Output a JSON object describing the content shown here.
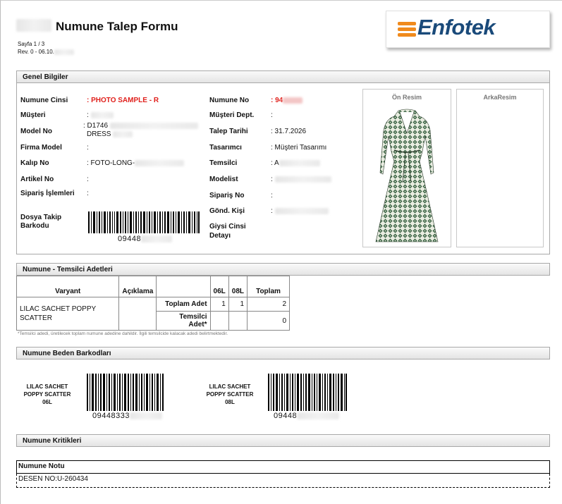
{
  "header": {
    "title": "Numune Talep Formu",
    "page": "Sayfa 1 / 3",
    "revision": "Rev. 0 - 06.10.",
    "logo_text": "Enfotek"
  },
  "sections": {
    "general": "Genel Bilgiler",
    "counts": "Numune - Temsilci Adetleri",
    "barcodes": "Numune Beden Barkodları",
    "criticals": "Numune Kritikleri"
  },
  "general": {
    "left": [
      {
        "label": "Numune Cinsi",
        "value": ": PHOTO SAMPLE - R"
      },
      {
        "label": "Müşteri",
        "value": ":"
      },
      {
        "label": "Model No",
        "value": ": D1746",
        "value2": "DRESS"
      },
      {
        "label": "Firma Model",
        "value": ":"
      },
      {
        "label": "Kalıp No",
        "value": ": FOTO-LONG-"
      },
      {
        "label": "Artikel No",
        "value": ":"
      },
      {
        "label": "Sipariş İşlemleri",
        "value": ":"
      },
      {
        "label": "Dosya Takip Barkodu",
        "value": "09448"
      }
    ],
    "right": [
      {
        "label": "Numune No",
        "value": ": 94"
      },
      {
        "label": "Müşteri Dept.",
        "value": ":"
      },
      {
        "label": "Talep Tarihi",
        "value": ": 31.7.2026"
      },
      {
        "label": "Tasarımcı",
        "value": ": Müşteri Tasarımı"
      },
      {
        "label": "Temsilci",
        "value": ": A"
      },
      {
        "label": "Modelist",
        "value": ":"
      },
      {
        "label": "Sipariş No",
        "value": ":"
      },
      {
        "label": "Gönd. Kişi",
        "value": ":"
      },
      {
        "label": "Giysi Cinsi Detayı",
        "value": ""
      }
    ],
    "front_image": "Ön Resim",
    "back_image": "ArkaResim"
  },
  "counts_table": {
    "headers": {
      "variant": "Varyant",
      "desc": "Açıklama",
      "s1": "06L",
      "s2": "08L",
      "total": "Toplam"
    },
    "variant": "LILAC SACHET POPPY SCATTER",
    "rows": [
      {
        "label": "Toplam Adet",
        "s1": "1",
        "s2": "1",
        "total": "2"
      },
      {
        "label": "Temsilci Adet*",
        "s1": "",
        "s2": "",
        "total": "0"
      }
    ],
    "note": "*Temsilci adedi, üretilecek toplam numune adedine dahildir. İlgili temsilcide kalacak adedi belirtmektedir."
  },
  "barcodes": [
    {
      "line1": "LILAC SACHET",
      "line2": "POPPY SCATTER",
      "size": "06L",
      "number": "09448333"
    },
    {
      "line1": "LILAC SACHET",
      "line2": "POPPY SCATTER",
      "size": "08L",
      "number": "09448"
    }
  ],
  "criticals": {
    "note_title": "Numune Notu",
    "note_text": "DESEN NO:U-260434"
  }
}
